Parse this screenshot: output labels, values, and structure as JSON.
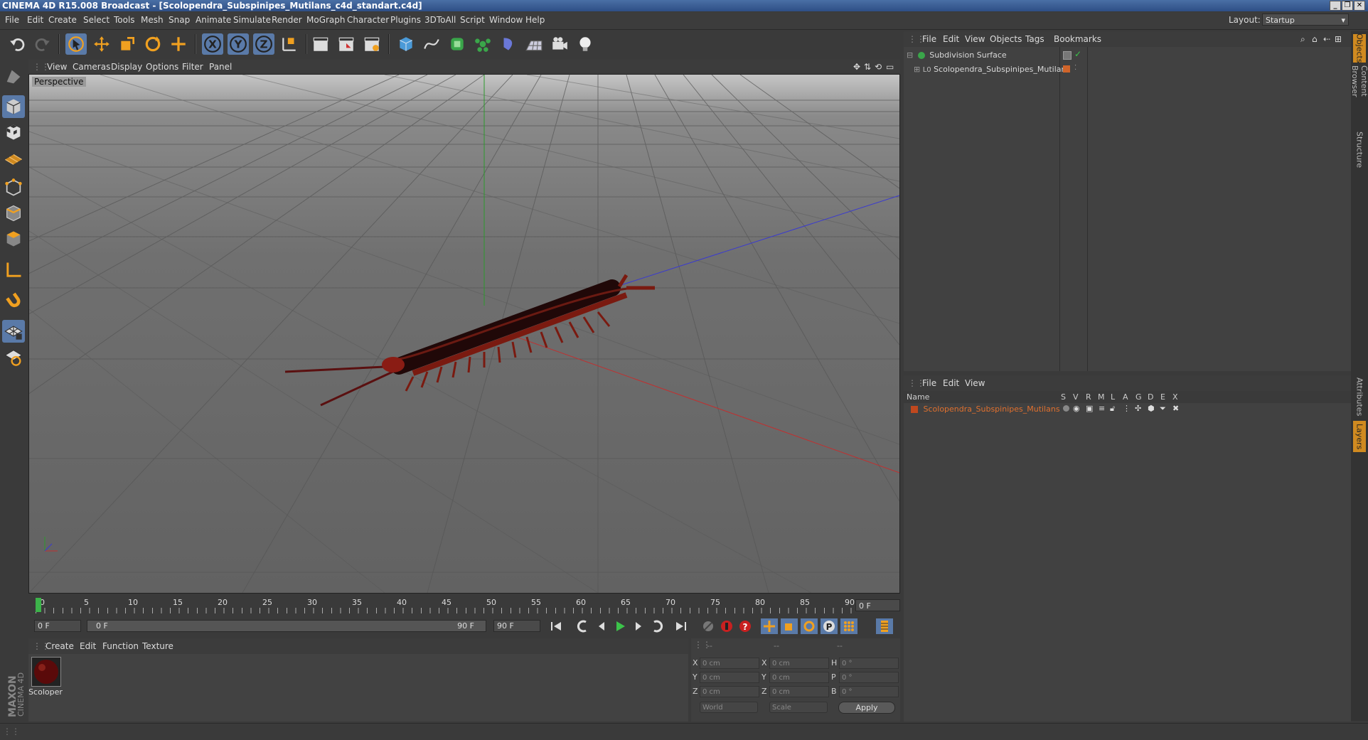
{
  "window": {
    "title": "CINEMA 4D R15.008 Broadcast - [Scolopendra_Subspinipes_Mutilans_c4d_standart.c4d]"
  },
  "menubar": {
    "items": [
      "File",
      "Edit",
      "Create",
      "Select",
      "Tools",
      "Mesh",
      "Snap",
      "Animate",
      "Simulate",
      "Render",
      "MoGraph",
      "Character",
      "Plugins",
      "3DToAll",
      "Script",
      "Window",
      "Help"
    ],
    "layout_label": "Layout:",
    "layout_value": "Startup"
  },
  "viewport": {
    "menu": [
      "View",
      "Cameras",
      "Display",
      "Options",
      "Filter",
      "Panel"
    ],
    "label": "Perspective"
  },
  "timeline": {
    "ticks": [
      "0",
      "5",
      "10",
      "15",
      "20",
      "25",
      "30",
      "35",
      "40",
      "45",
      "50",
      "55",
      "60",
      "65",
      "70",
      "75",
      "80",
      "85",
      "90"
    ],
    "frame_field": "0 F"
  },
  "transport": {
    "start_field": "0 F",
    "range_start": "0 F",
    "range_end": "90 F",
    "end_field": "90 F"
  },
  "material_manager": {
    "menu": [
      "Create",
      "Edit",
      "Function",
      "Texture"
    ],
    "material_name": "Scoloper"
  },
  "coordinates": {
    "header": [
      "--",
      "--",
      "--"
    ],
    "rows": [
      {
        "a": "X",
        "v1": "0 cm",
        "b": "X",
        "v2": "0 cm",
        "c": "H",
        "v3": "0 °"
      },
      {
        "a": "Y",
        "v1": "0 cm",
        "b": "Y",
        "v2": "0 cm",
        "c": "P",
        "v3": "0 °"
      },
      {
        "a": "Z",
        "v1": "0 cm",
        "b": "Z",
        "v2": "0 cm",
        "c": "B",
        "v3": "0 °"
      }
    ],
    "world": "World",
    "scale": "Scale",
    "apply": "Apply"
  },
  "object_manager": {
    "menu": [
      "File",
      "Edit",
      "View",
      "Objects",
      "Tags",
      "Bookmarks"
    ],
    "objects": [
      "Subdivision Surface",
      "Scolopendra_Subspinipes_Mutilans"
    ]
  },
  "layer_manager": {
    "menu": [
      "File",
      "Edit",
      "View"
    ],
    "columns": [
      "Name",
      "S",
      "V",
      "R",
      "M",
      "L",
      "A",
      "G",
      "D",
      "E",
      "X"
    ],
    "layers": [
      "Scolopendra_Subspinipes_Mutilans"
    ],
    "layer_color": "#c0481e"
  },
  "right_tabs": [
    "Objects",
    "Content Browser",
    "Structure",
    "Attributes",
    "Layers"
  ],
  "logo": {
    "line1": "MAXON",
    "line2": "CINEMA 4D"
  },
  "colors": {
    "accent_blue": "#4a6fa5",
    "layer_text": "#e0702e"
  }
}
